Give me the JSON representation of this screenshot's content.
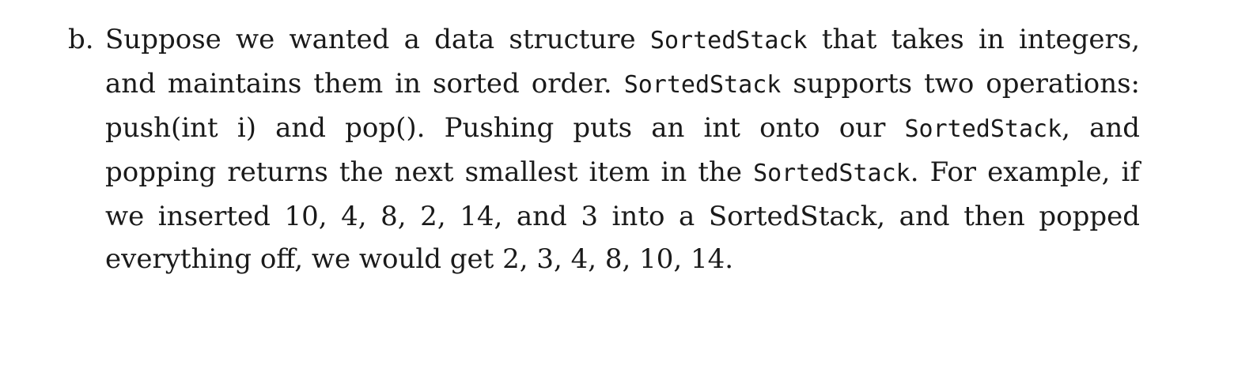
{
  "question": {
    "label": "b.",
    "segments": [
      {
        "type": "text",
        "value": "Suppose we wanted a data structure "
      },
      {
        "type": "code",
        "value": "SortedStack"
      },
      {
        "type": "text",
        "value": " that takes in integers, and maintains them in sorted order. "
      },
      {
        "type": "code",
        "value": "SortedStack"
      },
      {
        "type": "text",
        "value": " supports two operations: push(int i) and pop(). Pushing puts an int onto our "
      },
      {
        "type": "code",
        "value": "SortedStack"
      },
      {
        "type": "text",
        "value": ", and popping returns the next smallest item in the "
      },
      {
        "type": "code",
        "value": "SortedStack"
      },
      {
        "type": "text",
        "value": ". For example, if we inserted 10, 4, 8, 2, 14, and 3 into a SortedStack, and then popped everything off, we would get 2, 3, 4, 8, 10, 14."
      }
    ]
  }
}
